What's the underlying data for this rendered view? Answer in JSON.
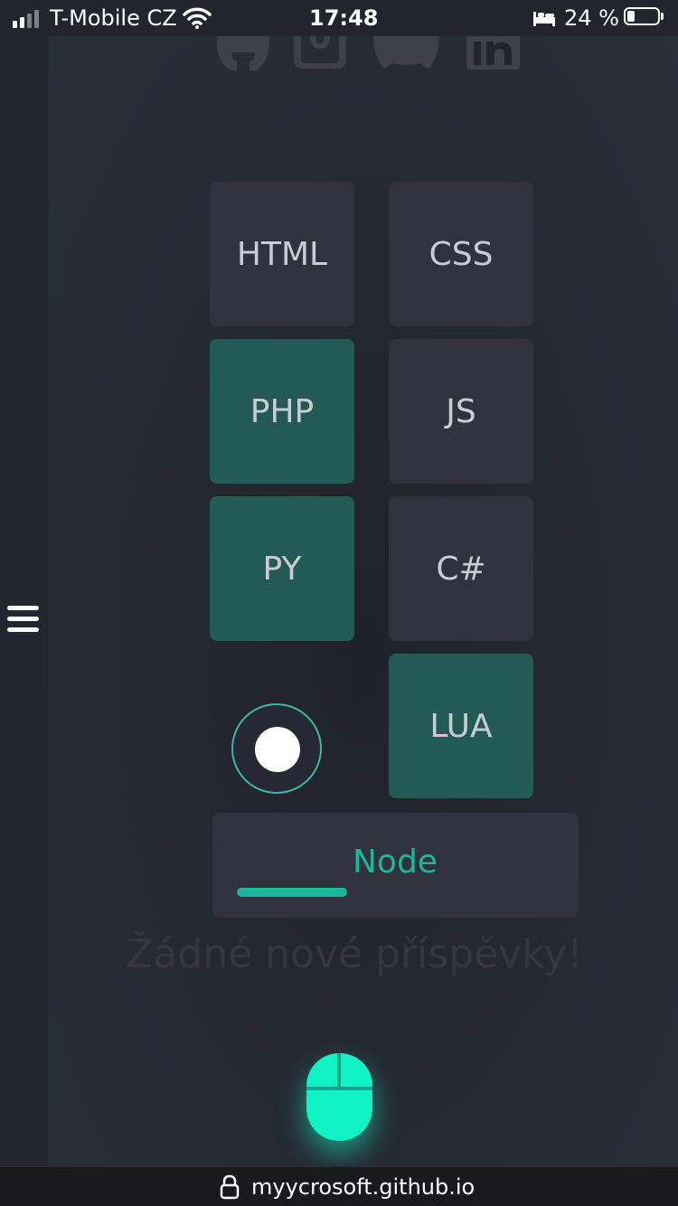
{
  "status": {
    "carrier": "T-Mobile CZ",
    "time": "17:48",
    "battery_percent": "24 %",
    "battery_level": 0.24,
    "signal_bars": 2,
    "icons": [
      "signal-icon",
      "wifi-icon",
      "bed-icon",
      "battery-icon"
    ]
  },
  "menu": {
    "icon": "hamburger-menu-icon"
  },
  "social_links": [
    "github-icon",
    "instagram-icon",
    "discord-icon",
    "linkedin-icon"
  ],
  "skills": {
    "html": {
      "label": "HTML",
      "active": false
    },
    "css": {
      "label": "CSS",
      "active": false
    },
    "php": {
      "label": "PHP",
      "active": true
    },
    "js": {
      "label": "JS",
      "active": false
    },
    "py": {
      "label": "PY",
      "active": true
    },
    "csharp": {
      "label": "C#",
      "active": false
    },
    "lua": {
      "label": "LUA",
      "active": true
    }
  },
  "node": {
    "label": "Node",
    "progress": 0.3
  },
  "colors": {
    "accent": "#1ab59b",
    "active_tile": "#235a55",
    "tile": "#30323d",
    "mouse_glow": "#12f3c5"
  },
  "posts": {
    "empty_message": "Žádné nové příspěvky!"
  },
  "scroll_hint": {
    "icon": "mouse-icon"
  },
  "browser": {
    "url": "myycrosoft.github.io",
    "icon": "lock-icon"
  }
}
